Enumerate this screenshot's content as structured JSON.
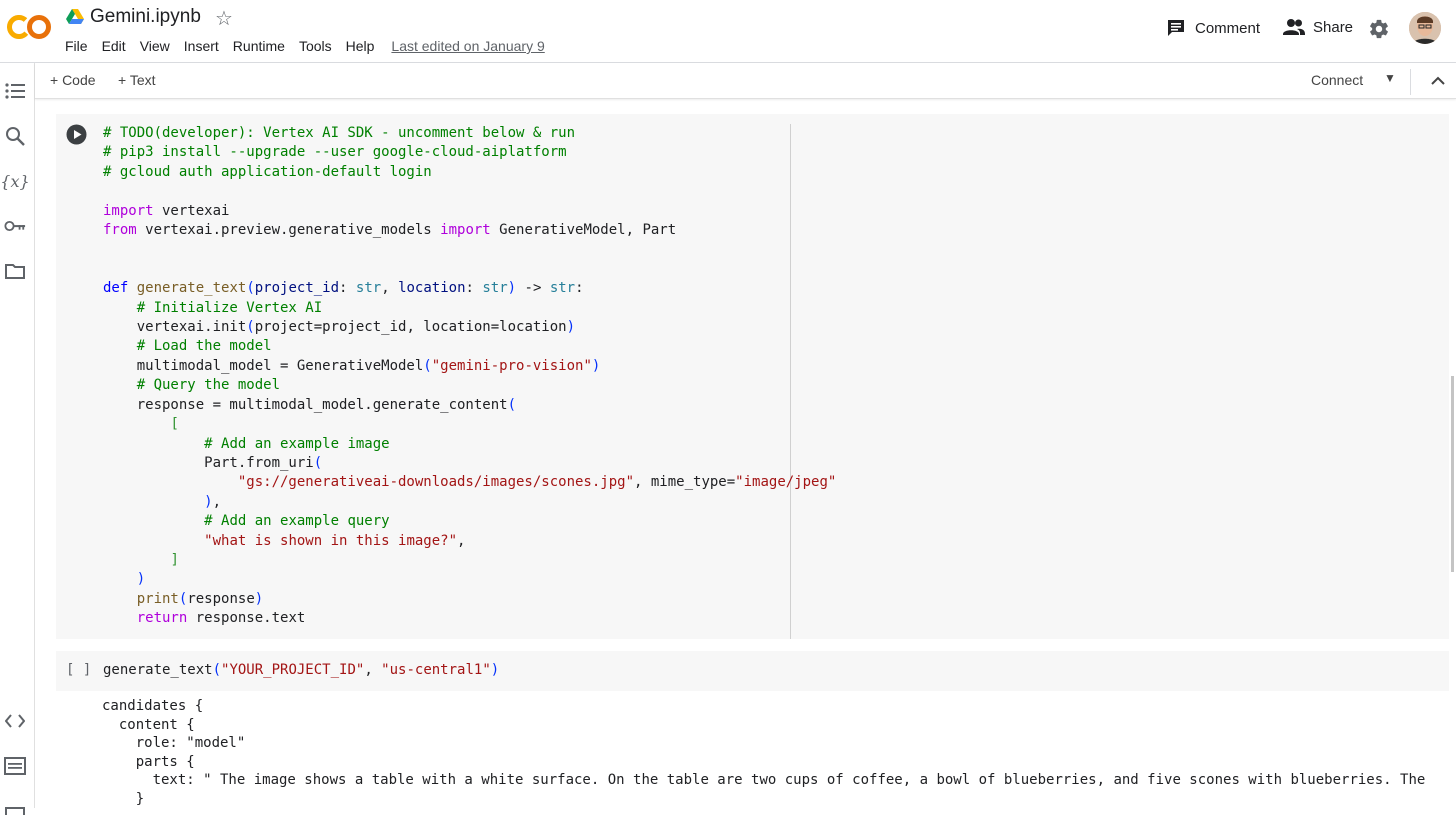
{
  "header": {
    "title": "Gemini.ipynb",
    "menu": [
      "File",
      "Edit",
      "View",
      "Insert",
      "Runtime",
      "Tools",
      "Help"
    ],
    "last_edited": "Last edited on January 9",
    "comment_label": "Comment",
    "share_label": "Share",
    "logo_text": "CO"
  },
  "toolbar": {
    "code_label": "+ Code",
    "text_label": "+ Text",
    "connect_label": "Connect"
  },
  "cell1": {
    "lines": [
      "# TODO(developer): Vertex AI SDK - uncomment below & run",
      "# pip3 install --upgrade --user google-cloud-aiplatform",
      "# gcloud auth application-default login",
      "",
      "import vertexai",
      "from vertexai.preview.generative_models import GenerativeModel, Part",
      "",
      "",
      "def generate_text(project_id: str, location: str) -> str:",
      "    # Initialize Vertex AI",
      "    vertexai.init(project=project_id, location=location)",
      "    # Load the model",
      "    multimodal_model = GenerativeModel(\"gemini-pro-vision\")",
      "    # Query the model",
      "    response = multimodal_model.generate_content(",
      "        [",
      "            # Add an example image",
      "            Part.from_uri(",
      "                \"gs://generativeai-downloads/images/scones.jpg\", mime_type=\"image/jpeg\"",
      "            ),",
      "            # Add an example query",
      "            \"what is shown in this image?\",",
      "        ]",
      "    )",
      "    print(response)",
      "    return response.text"
    ]
  },
  "cell2": {
    "prompt": "[ ]",
    "code": "generate_text(\"YOUR_PROJECT_ID\", \"us-central1\")"
  },
  "output": {
    "lines": [
      "candidates {",
      "  content {",
      "    role: \"model\"",
      "    parts {",
      "      text: \" The image shows a table with a white surface. On the table are two cups of coffee, a bowl of blueberries, and five scones with blueberries. The",
      "    }"
    ]
  }
}
